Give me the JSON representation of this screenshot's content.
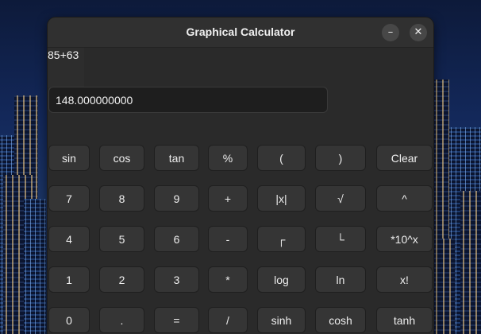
{
  "window": {
    "title": "Graphical Calculator",
    "minimize_glyph": "–",
    "close_glyph": "✕"
  },
  "display": {
    "expression": "85+63",
    "result": "148.000000000"
  },
  "keypad": {
    "rows": [
      [
        "sin",
        "cos",
        "tan",
        "%",
        "(",
        ")",
        "Clear"
      ],
      [
        "7",
        "8",
        "9",
        "+",
        "|x|",
        "√",
        "^"
      ],
      [
        "4",
        "5",
        "6",
        "-",
        "┌",
        "└",
        "*10^x"
      ],
      [
        "1",
        "2",
        "3",
        "*",
        "log",
        "ln",
        "x!"
      ],
      [
        "0",
        ".",
        "=",
        "/",
        "sinh",
        "cosh",
        "tanh"
      ]
    ]
  }
}
